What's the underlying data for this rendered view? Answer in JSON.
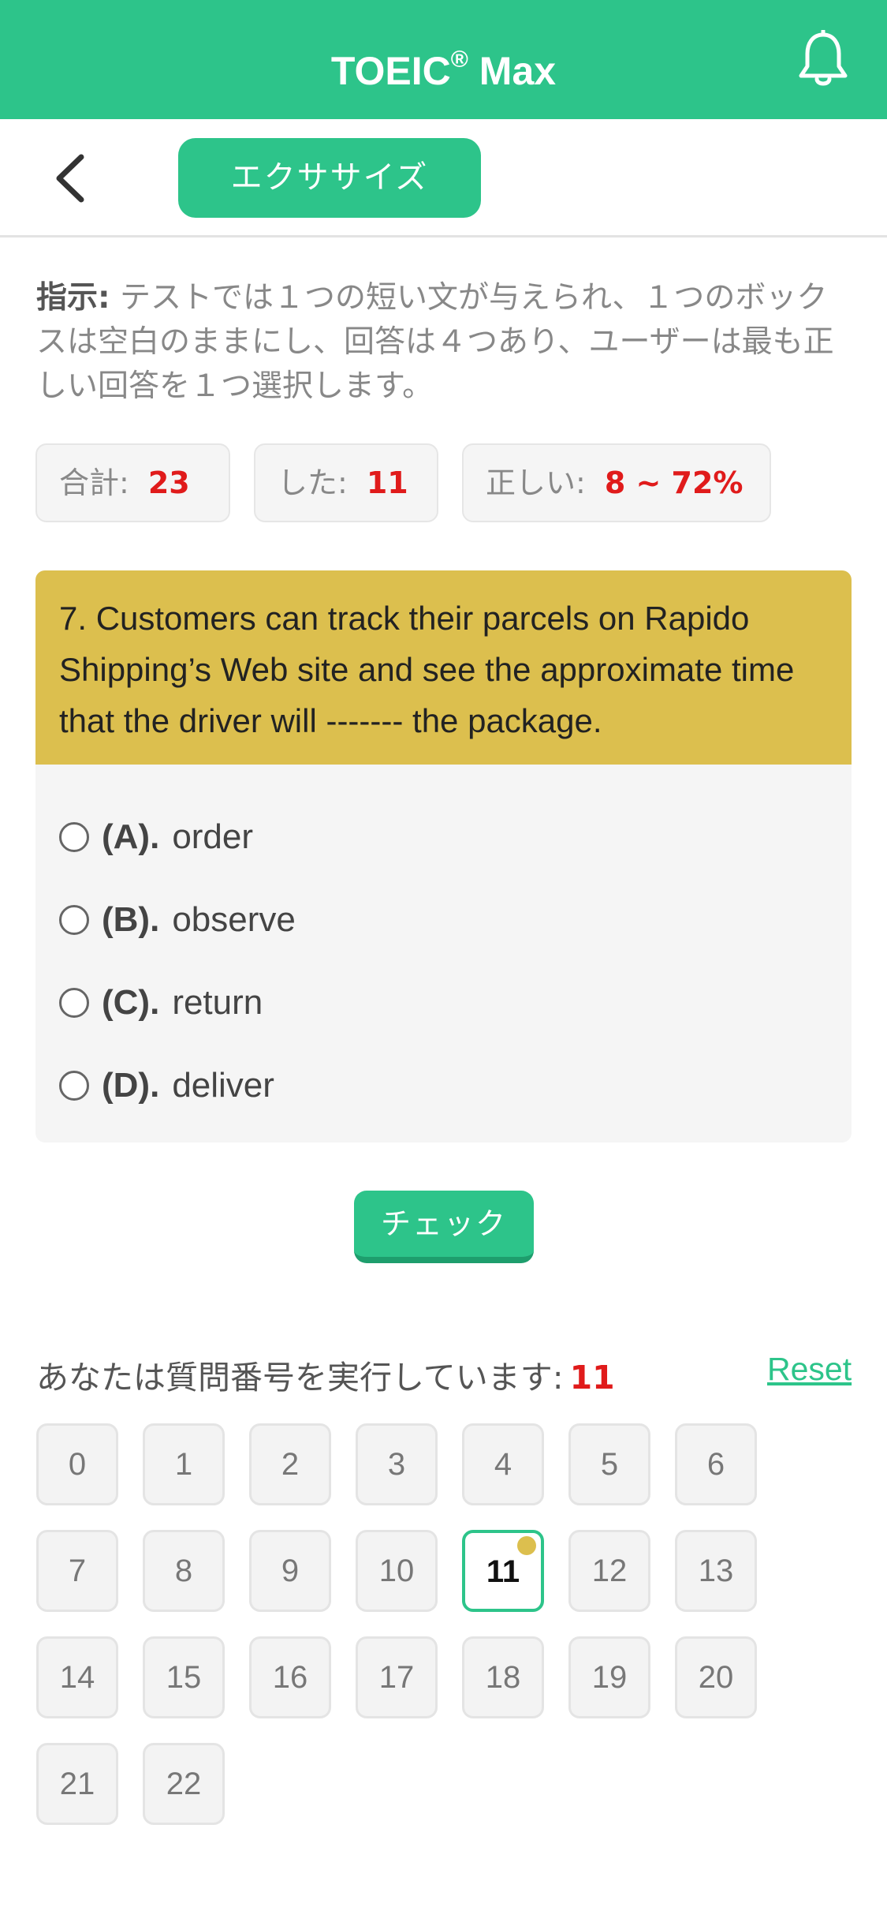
{
  "header": {
    "title": "TOEIC",
    "title_mark": "®",
    "title_suffix": " Max"
  },
  "subbar": {
    "tab_label": "エクササイズ"
  },
  "instruction": {
    "label": "指示:",
    "text": " テストでは１つの短い文が与えられ、１つのボックスは空白のままにし、回答は４つあり、ユーザーは最も正しい回答を１つ選択します。"
  },
  "stats": {
    "total_label": "合計:",
    "total_value": "23",
    "done_label": "した:",
    "done_value": "11",
    "correct_label": "正しい:",
    "correct_value": "8 ~ 72%"
  },
  "question": {
    "text": "7. Customers can track their parcels on Rapido Shipping’s Web site and see the approximate time that the driver will ------- the package.",
    "options": [
      {
        "letter": "(A).",
        "text": "order"
      },
      {
        "letter": "(B).",
        "text": "observe"
      },
      {
        "letter": "(C).",
        "text": "return"
      },
      {
        "letter": "(D).",
        "text": "deliver"
      }
    ]
  },
  "check_label": "チェック",
  "progress": {
    "label": "あなたは質問番号を実行しています:",
    "current": "11",
    "reset_label": "Reset"
  },
  "numbers": [
    "0",
    "1",
    "2",
    "3",
    "4",
    "5",
    "6",
    "7",
    "8",
    "9",
    "10",
    "11",
    "12",
    "13",
    "14",
    "15",
    "16",
    "17",
    "18",
    "19",
    "20",
    "21",
    "22"
  ],
  "active_number": "11",
  "colors": {
    "accent": "#2DC48A",
    "question_bg": "#DCBF4E",
    "highlight_red": "#E01B1B"
  }
}
